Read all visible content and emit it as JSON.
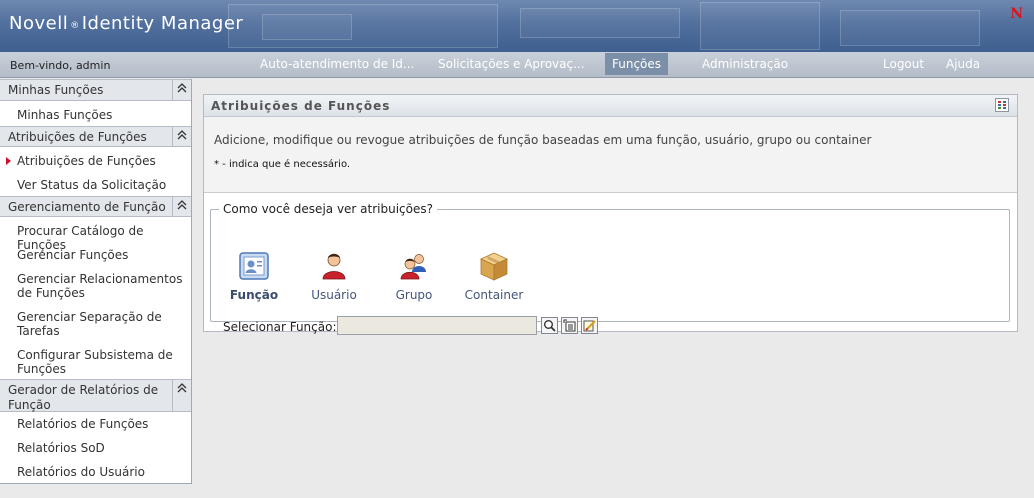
{
  "header": {
    "brand": "Novell",
    "reg": "®",
    "product": "Identity Manager",
    "logo_letter": "N",
    "logo_color": "#d9141c"
  },
  "nav": {
    "welcome": "Bem-vindo, admin",
    "tabs": [
      {
        "label": "Auto-atendimento de Id..."
      },
      {
        "label": "Solicitações e Aprovaç..."
      },
      {
        "label": "Funções",
        "active": true
      },
      {
        "label": "Administração"
      }
    ],
    "logout": "Logout",
    "help": "Ajuda"
  },
  "sidebar": {
    "sections": [
      {
        "title": "Minhas Funções",
        "items": [
          {
            "label": "Minhas Funções"
          }
        ]
      },
      {
        "title": "Atribuições de Funções",
        "items": [
          {
            "label": "Atribuições de Funções",
            "current": true
          },
          {
            "label": "Ver Status da Solicitação"
          }
        ]
      },
      {
        "title": "Gerenciamento de Função",
        "items": [
          {
            "label": "Procurar Catálogo de Funções"
          },
          {
            "label": "Gerenciar Funções"
          },
          {
            "label": "Gerenciar Relacionamentos de Funções"
          },
          {
            "label": "Gerenciar Separação de Tarefas"
          },
          {
            "label": "Configurar Subsistema de Funções"
          }
        ]
      },
      {
        "title": "Gerador de Relatórios de Função",
        "items": [
          {
            "label": "Relatórios de Funções"
          },
          {
            "label": "Relatórios SoD"
          },
          {
            "label": "Relatórios do Usuário"
          }
        ]
      }
    ]
  },
  "main": {
    "title": "Atribuições de Funções",
    "description": "Adicione, modifique ou revogue atribuições de função baseadas em uma função, usuário, grupo ou container",
    "required_note": "* - indica que é necessário.",
    "view_question": "Como você deseja ver atribuições?",
    "options": [
      {
        "label": "Função",
        "icon": "role-icon",
        "selected": true
      },
      {
        "label": "Usuário",
        "icon": "user-icon"
      },
      {
        "label": "Grupo",
        "icon": "group-icon"
      },
      {
        "label": "Container",
        "icon": "container-icon"
      }
    ],
    "select_label": "Selecionar Função:",
    "select_value": ""
  }
}
